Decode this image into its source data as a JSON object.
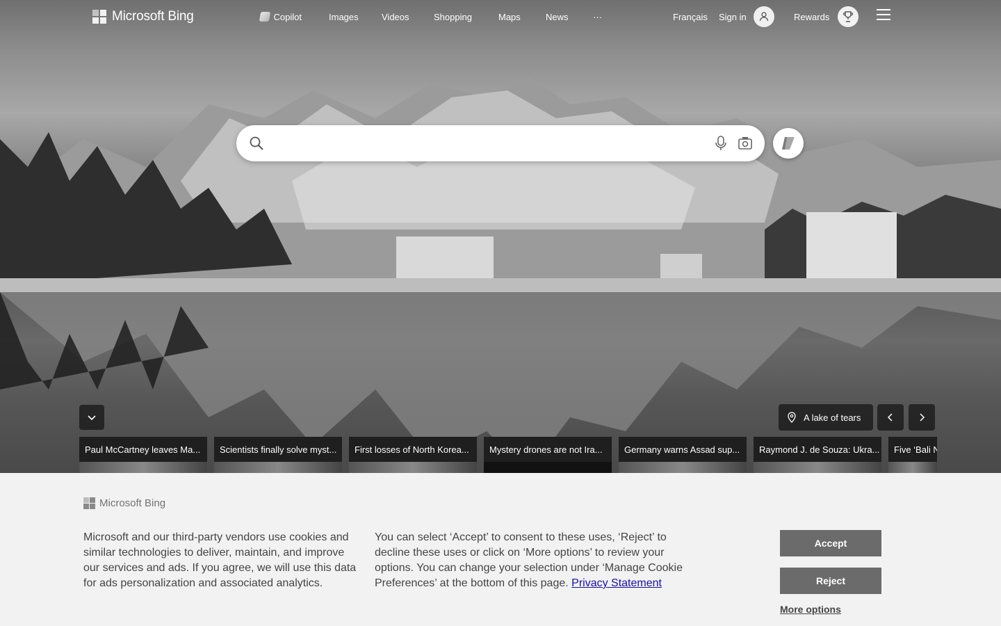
{
  "header": {
    "brand": "Microsoft Bing",
    "nav": [
      {
        "label": "Copilot",
        "icon": "copilot-icon"
      },
      {
        "label": "Images"
      },
      {
        "label": "Videos"
      },
      {
        "label": "Shopping"
      },
      {
        "label": "Maps"
      },
      {
        "label": "News"
      },
      {
        "label": "···"
      }
    ],
    "language": "Français",
    "signin": "Sign in",
    "rewards": "Rewards",
    "menu_icon": "hamburger-menu-icon"
  },
  "search": {
    "value": "",
    "placeholder": "",
    "icons": [
      "search-icon",
      "microphone-icon",
      "visual-search-icon",
      "copilot-icon"
    ]
  },
  "background": {
    "location_label": "A lake of tears"
  },
  "news": [
    {
      "title": "Paul McCartney leaves Ma..."
    },
    {
      "title": "Scientists finally solve myst..."
    },
    {
      "title": "First losses of North Korea..."
    },
    {
      "title": "Mystery drones are not Ira..."
    },
    {
      "title": "Germany warns Assad sup..."
    },
    {
      "title": "Raymond J. de Souza: Ukra..."
    },
    {
      "title": "Five ‘Bali N"
    }
  ],
  "cookie": {
    "brand": "Microsoft Bing",
    "text1": "Microsoft and our third-party vendors use cookies and similar technologies to deliver, maintain, and improve our services and ads. If you agree, we will use this data for ads personalization and associated analytics.",
    "text2": "You can select ‘Accept’ to consent to these uses, ‘Reject’ to decline these uses or click on ‘More options’ to review your options. You can change your selection under ‘Manage Cookie Preferences’ at the bottom of this page.",
    "privacy_link": "Privacy Statement",
    "accept": "Accept",
    "reject": "Reject",
    "more_options": "More options"
  },
  "colors": {
    "button_gray": "#6b6b6b",
    "banner_bg": "#f2f2f2",
    "link": "#1a0dab"
  }
}
